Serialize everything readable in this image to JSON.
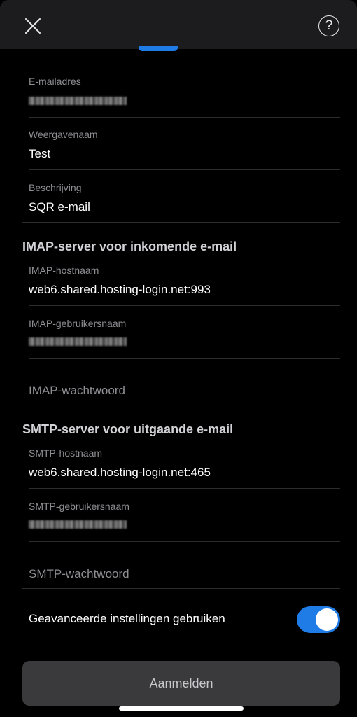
{
  "header": {
    "close_icon": "close-icon",
    "help_label": "?"
  },
  "account": {
    "email_label": "E-mailadres",
    "display_name_label": "Weergavenaam",
    "display_name_value": "Test",
    "description_label": "Beschrijving",
    "description_value": "SQR e-mail"
  },
  "imap": {
    "section_title": "IMAP-server voor inkomende e-mail",
    "hostname_label": "IMAP-hostnaam",
    "hostname_value": "web6.shared.hosting-login.net:993",
    "username_label": "IMAP-gebruikersnaam",
    "password_placeholder": "IMAP-wachtwoord"
  },
  "smtp": {
    "section_title": "SMTP-server voor uitgaande e-mail",
    "hostname_label": "SMTP-hostnaam",
    "hostname_value": "web6.shared.hosting-login.net:465",
    "username_label": "SMTP-gebruikersnaam",
    "password_placeholder": "SMTP-wachtwoord"
  },
  "advanced": {
    "label": "Geavanceerde instellingen gebruiken",
    "enabled": true,
    "accent_color": "#1f7be6"
  },
  "footer": {
    "signin_label": "Aanmelden"
  }
}
